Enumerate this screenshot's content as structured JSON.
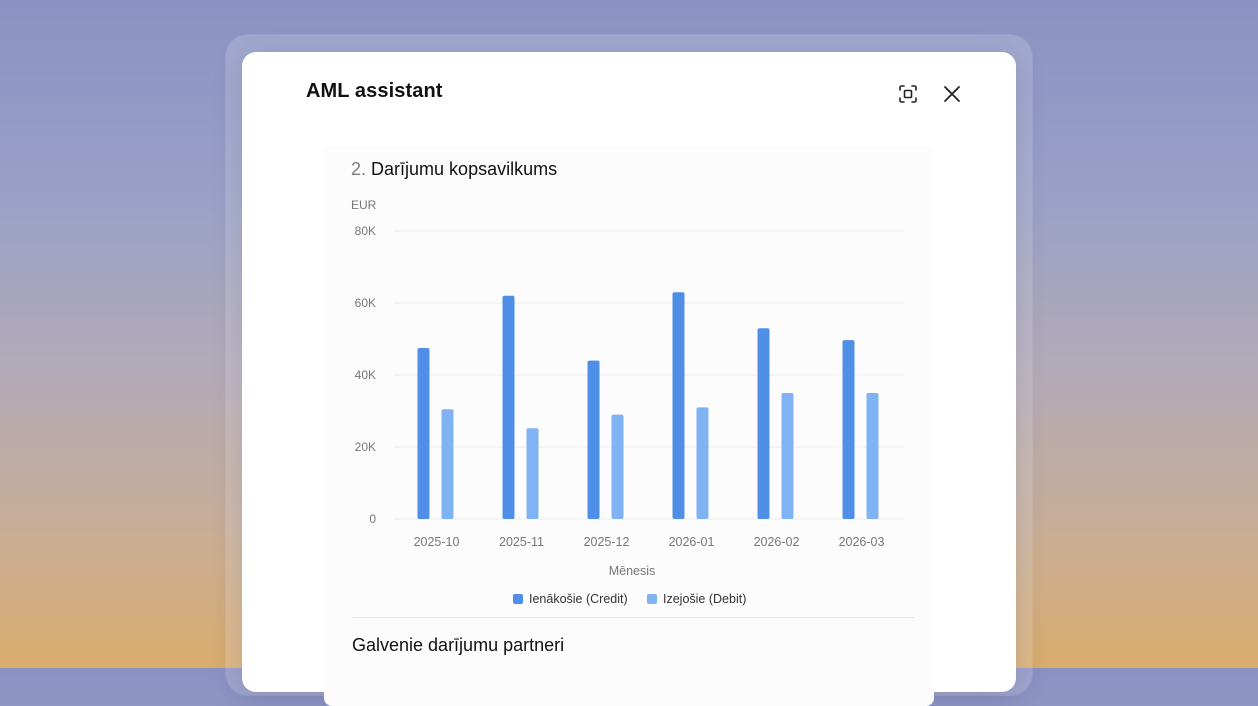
{
  "modal": {
    "title": "AML assistant",
    "icons": {
      "focus": "focus-frame-icon",
      "close": "close-icon"
    }
  },
  "section": {
    "number": "2.",
    "title": "Darījumu kopsavilkums"
  },
  "next_section": {
    "title": "Galvenie darījumu partneri"
  },
  "colors": {
    "credit": "#4f8fe8",
    "debit": "#7fb3f3",
    "grid": "#ececec",
    "tick": "#777777"
  },
  "chart_data": {
    "type": "bar",
    "unit_label": "EUR",
    "xlabel": "Mēnesis",
    "categories": [
      "2025-10",
      "2025-11",
      "2025-12",
      "2026-01",
      "2026-02",
      "2026-03"
    ],
    "ylim": [
      0,
      80000
    ],
    "yticks": [
      0,
      20000,
      40000,
      60000,
      80000
    ],
    "ytick_labels": [
      "0",
      "20K",
      "40K",
      "60K",
      "80K"
    ],
    "series": [
      {
        "name": "Ienākošie (Credit)",
        "values": [
          47500,
          62000,
          44000,
          63000,
          53000,
          49700
        ]
      },
      {
        "name": "Izejošie (Debit)",
        "values": [
          30500,
          25200,
          29000,
          31000,
          35000,
          35000
        ]
      }
    ],
    "legend": "bottom-center",
    "grid": true
  }
}
